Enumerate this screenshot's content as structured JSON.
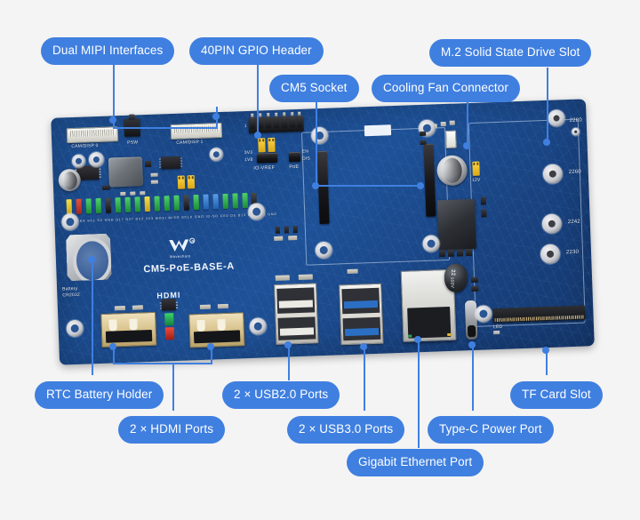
{
  "page": {
    "background_color": "#f4f4f4",
    "accent_color": "#3f7fe0",
    "board_color": "#1d4f91"
  },
  "product": {
    "silkscreen_model": "CM5-PoE-BASE-A",
    "brand": "Waveshare",
    "brand_mark": "®"
  },
  "callouts": [
    {
      "id": "dual-mipi-interfaces",
      "label": "Dual MIPI Interfaces"
    },
    {
      "id": "40pin-gpio-header",
      "label": "40PIN GPIO Header"
    },
    {
      "id": "cm5-socket",
      "label": "CM5 Socket"
    },
    {
      "id": "cooling-fan-connector",
      "label": "Cooling Fan Connector"
    },
    {
      "id": "m2-ssd-slot",
      "label": "M.2 Solid State Drive Slot"
    },
    {
      "id": "rtc-battery-holder",
      "label": "RTC Battery Holder"
    },
    {
      "id": "hdmi-ports",
      "label": "2 × HDMI Ports"
    },
    {
      "id": "usb20-ports",
      "label": "2 × USB2.0 Ports"
    },
    {
      "id": "usb30-ports",
      "label": "2 × USB3.0 Ports"
    },
    {
      "id": "gigabit-ethernet-port",
      "label": "Gigabit Ethernet Port"
    },
    {
      "id": "typec-power-port",
      "label": "Type-C Power Port"
    },
    {
      "id": "tf-card-slot",
      "label": "TF Card Slot"
    }
  ],
  "silkscreen": {
    "cam_disp_0": "CAM/DISP 0",
    "cam_disp_1": "CAM/DISP 1",
    "psw": "PSW",
    "io_vref": "IO-VREF",
    "poe": "PoE",
    "vref_3v3": "3V3",
    "vref_1v8": "1V8",
    "poe_en": "EN",
    "poe_dis": "DIS",
    "hdmi": "HDMI",
    "battery": "Battery",
    "battery_type": "CR2032",
    "led": "LED",
    "fan_12v": "12V",
    "m2_2280": "2280",
    "m2_2260": "2260",
    "m2_2242": "2242",
    "m2_2230": "2230",
    "cap_value": "22",
    "cap_voltage": "100V",
    "gpio_pin1": "1",
    "gpio_labels": "3V3 SDA SCL 5V GND D17 D27 D22 3V3 MOSI MISO SCLK GND ID-SD CE0 D5 D13 D19 D26 GND"
  }
}
